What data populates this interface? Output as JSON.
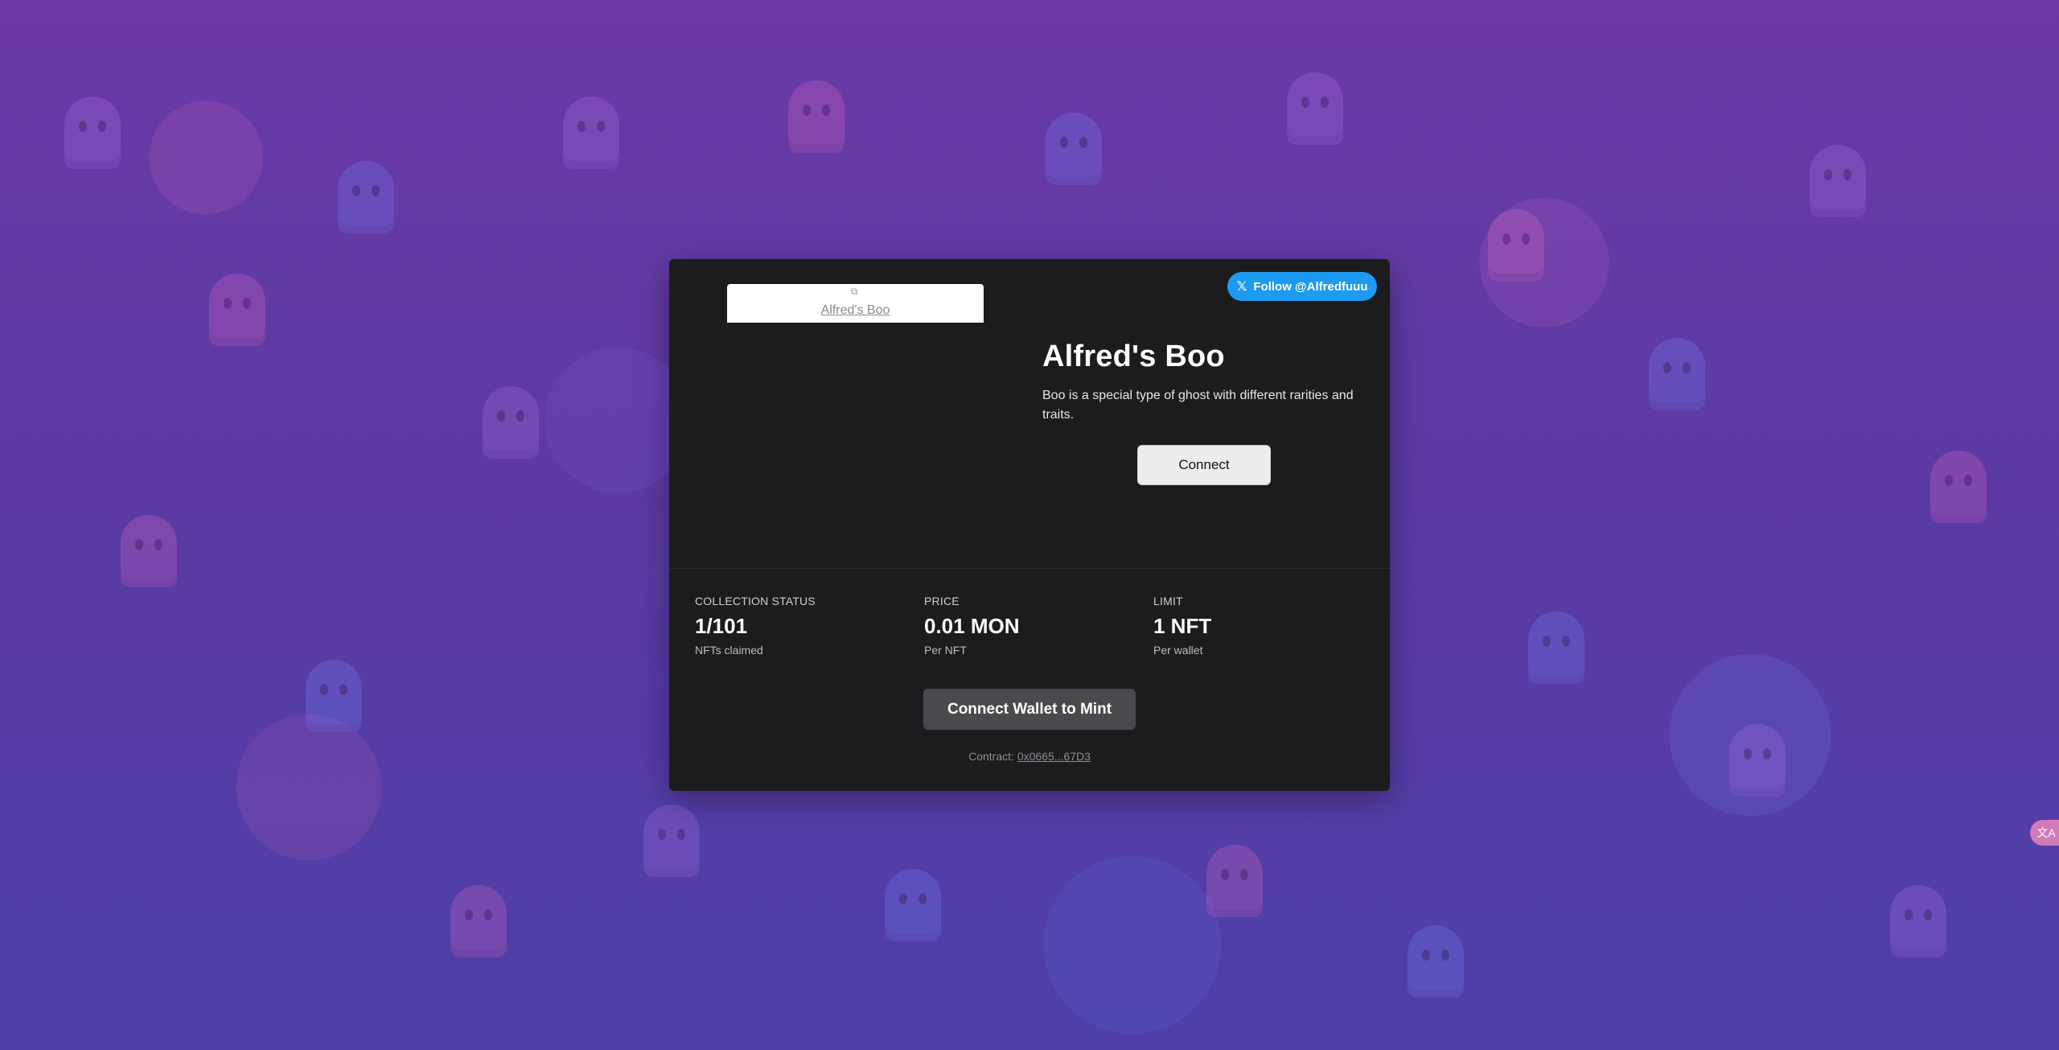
{
  "follow_button": {
    "label": "Follow @Alfredfuuu",
    "icon": "x-logo-icon"
  },
  "nft_image": {
    "alt": "Alfred's Boo"
  },
  "collection": {
    "title": "Alfred's Boo",
    "description": "Boo is a special type of ghost with different rarities and traits."
  },
  "connect_button": {
    "label": "Connect"
  },
  "stats": {
    "status": {
      "label": "Collection Status",
      "value": "1/101",
      "sub": "NFTs claimed"
    },
    "price": {
      "label": "Price",
      "value": "0.01 MON",
      "sub": "Per NFT"
    },
    "limit": {
      "label": "Limit",
      "value": "1 NFT",
      "sub": "Per wallet"
    }
  },
  "mint_button": {
    "label": "Connect Wallet to Mint"
  },
  "contract": {
    "label": "Contract:",
    "address": "0x0665...67D3"
  },
  "colors": {
    "card_bg": "#1c1c1e",
    "twitter_blue": "#1d9bf0",
    "page_bg": "#5c3aa3"
  }
}
